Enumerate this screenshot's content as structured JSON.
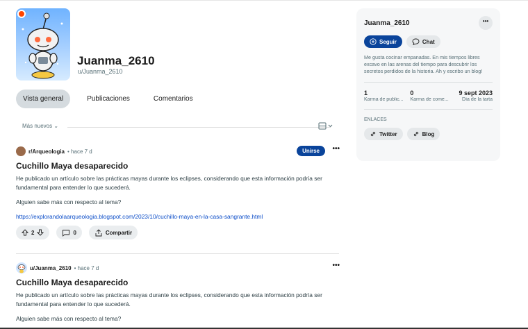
{
  "profile": {
    "display_name": "Juanma_2610",
    "username": "u/Juanma_2610"
  },
  "tabs": [
    "Vista general",
    "Publicaciones",
    "Comentarios"
  ],
  "sort": {
    "label": "Más nuevos",
    "chevron": "⌄"
  },
  "post1": {
    "subreddit": "r/Arqueologia",
    "time": "• hace 7 d",
    "join_label": "Unirse",
    "title": "Cuchillo Maya desaparecido",
    "body": "He publicado un artículo sobre las prácticas mayas durante los eclipses, considerando que esta información podría ser fundamental para entender lo que sucederá.",
    "question": "Alguien sabe más con respecto al tema?",
    "link": "https://explorandolaarqueologia.blogspot.com/2023/10/cuchillo-maya-en-la-casa-sangrante.html",
    "votes": "2",
    "comments": "0",
    "share_label": "Compartir"
  },
  "post2": {
    "author": "u/Juanma_2610",
    "time": "• hace 7 d",
    "title": "Cuchillo Maya desaparecido",
    "body": "He publicado un artículo sobre las prácticas mayas durante los eclipses, considerando que esta información podría ser fundamental para entender lo que sucederá.",
    "question": "Alguien sabe más con respecto al tema?"
  },
  "sidebar": {
    "name": "Juanma_2610",
    "follow_label": "Seguir",
    "chat_label": "Chat",
    "bio": "Me gusta cocinar empanadas. En mis tiempos libres excavo en las arenas del tiempo para descubrir los secretos perdidos de la historia. Ah y escribo un blog!",
    "stats": [
      {
        "value": "1",
        "label": "Karma de public..."
      },
      {
        "value": "0",
        "label": "Karma de come..."
      },
      {
        "value": "9 sept 2023",
        "label": "Día de la tarta"
      }
    ],
    "links_title": "ENLACES",
    "links": [
      "Twitter",
      "Blog"
    ]
  },
  "colors": {
    "accent": "#0a449b",
    "link": "#0a4cc8",
    "badge": "#ff4500"
  },
  "icons": [
    "avatar-icon",
    "chevron-down-icon",
    "view-card-icon",
    "upvote-icon",
    "downvote-icon",
    "comment-icon",
    "share-icon",
    "more-icon",
    "plus-circle-icon",
    "chat-icon",
    "link-icon"
  ]
}
